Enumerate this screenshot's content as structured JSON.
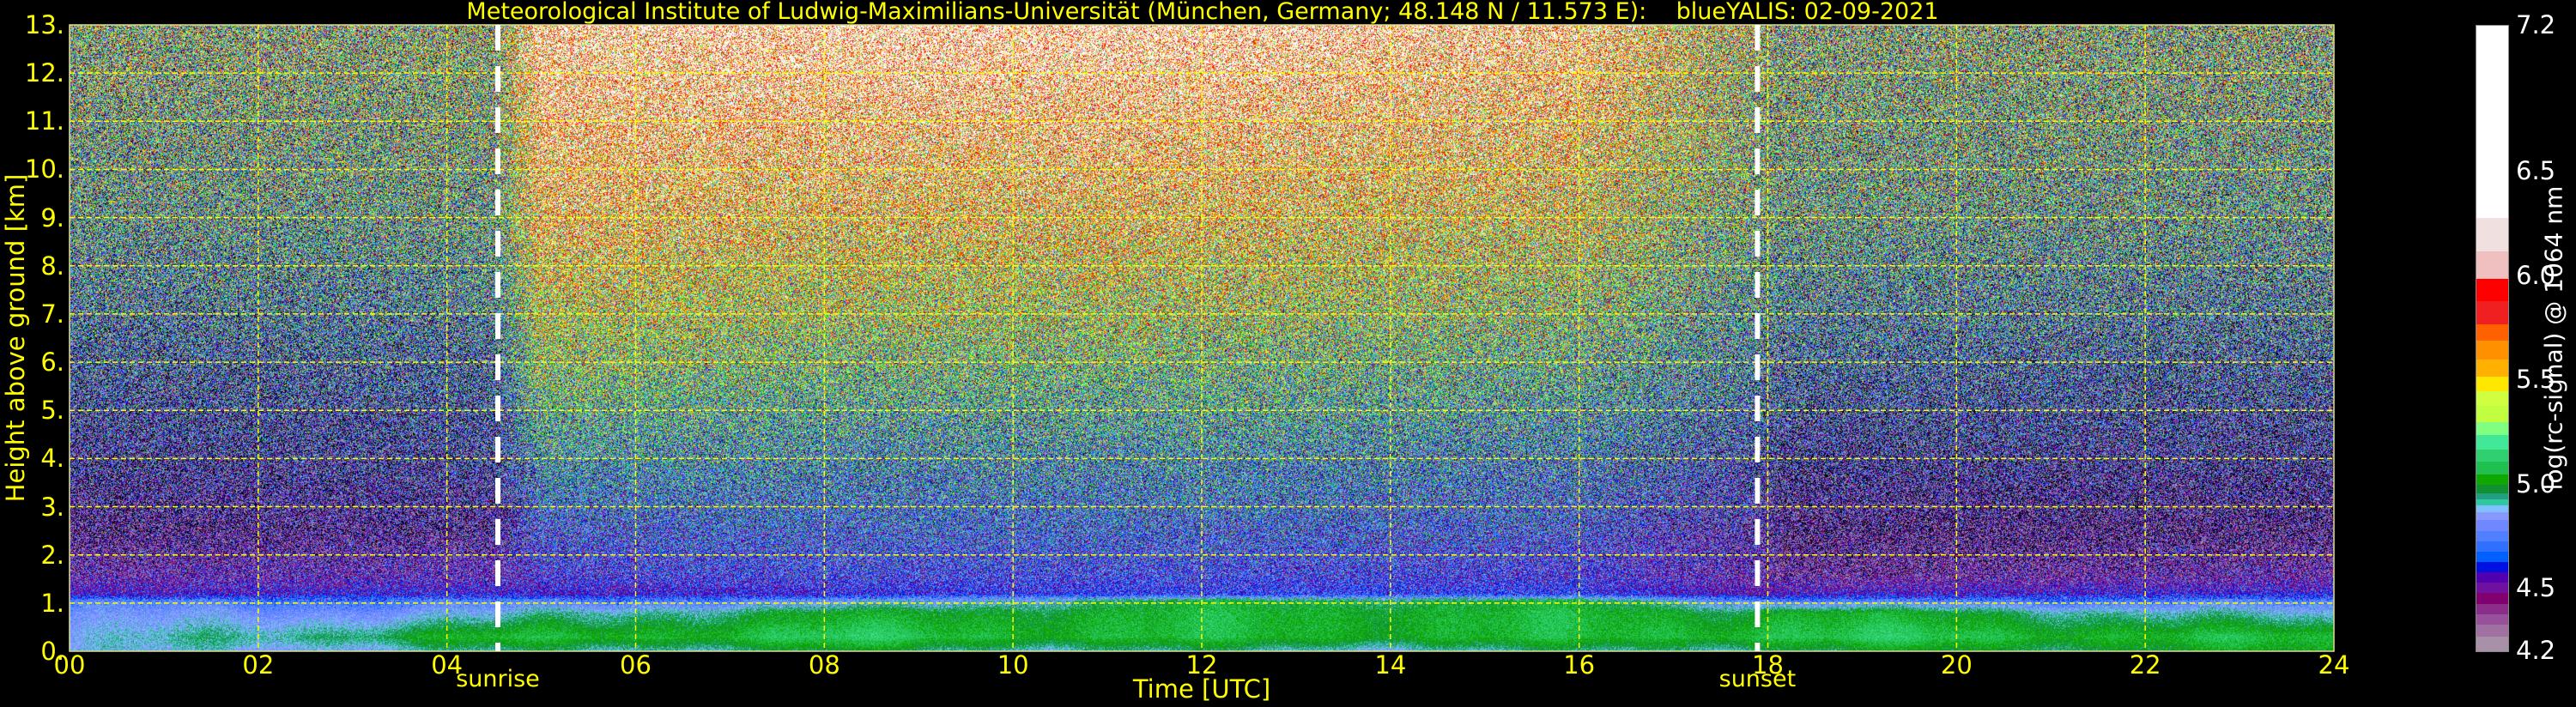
{
  "title": "Meteorological Institute of Ludwig-Maximilians-Universität (München, Germany; 48.148 N / 11.573 E):    blueYALIS: 02-09-2021",
  "chart_data": {
    "type": "heatmap",
    "title": "Meteorological Institute of Ludwig-Maximilians-Universität (München, Germany; 48.148 N / 11.573 E):    blueYALIS: 02-09-2021",
    "xlabel": "Time [UTC]",
    "ylabel": "Height above ground [km]",
    "xlim": [
      0,
      24
    ],
    "ylim": [
      0,
      13
    ],
    "grid": true,
    "grid_color": "#ffff00",
    "x_ticks": [
      0,
      2,
      4,
      6,
      8,
      10,
      12,
      14,
      16,
      18,
      20,
      22,
      24
    ],
    "x_tick_labels": [
      "00",
      "02",
      "04",
      "06",
      "08",
      "10",
      "12",
      "14",
      "16",
      "18",
      "20",
      "22",
      "24"
    ],
    "y_ticks": [
      0,
      1,
      2,
      3,
      4,
      5,
      6,
      7,
      8,
      9,
      10,
      11,
      12,
      13
    ],
    "y_tick_labels": [
      "0.",
      "1.",
      "2.",
      "3.",
      "4.",
      "5.",
      "6.",
      "7.",
      "8.",
      "9.",
      "10.",
      "11.",
      "12.",
      "13."
    ],
    "annotations": [
      {
        "label": "sunrise",
        "time": 4.54
      },
      {
        "label": "sunset",
        "time": 17.89
      }
    ],
    "field": {
      "quantity": "log(rc-signal) @ 1064 nm",
      "times": [
        0,
        4.5,
        5,
        8,
        12,
        16,
        17.9,
        18.2,
        24
      ],
      "heights": [
        0,
        0.3,
        0.8,
        1.05,
        1.2,
        1.6,
        2.5,
        4,
        6,
        9,
        13
      ],
      "mean_values": [
        [
          4.85,
          4.9,
          4.9,
          4.95,
          4.9,
          4.9,
          4.95,
          4.95,
          5.0
        ],
        [
          4.85,
          5.05,
          5.05,
          5.1,
          5.05,
          5.05,
          5.1,
          5.1,
          5.05
        ],
        [
          4.8,
          4.85,
          4.9,
          5.0,
          5.05,
          5.05,
          5.0,
          5.05,
          4.85
        ],
        [
          4.75,
          4.75,
          4.75,
          4.8,
          5.0,
          5.0,
          4.8,
          4.75,
          4.75
        ],
        [
          4.55,
          4.6,
          4.55,
          4.6,
          4.65,
          4.65,
          4.5,
          4.55,
          4.6
        ],
        [
          4.45,
          4.5,
          4.6,
          4.65,
          4.65,
          4.6,
          4.45,
          4.4,
          4.45
        ],
        [
          4.35,
          4.4,
          4.65,
          4.7,
          4.7,
          4.65,
          4.45,
          4.35,
          4.35
        ],
        [
          4.45,
          4.5,
          4.85,
          4.8,
          4.8,
          4.75,
          4.55,
          4.45,
          4.45
        ],
        [
          4.6,
          4.65,
          5.2,
          5.1,
          5.1,
          5.0,
          4.75,
          4.65,
          4.6
        ],
        [
          4.9,
          4.95,
          5.7,
          5.6,
          5.6,
          5.45,
          5.0,
          4.95,
          4.9
        ],
        [
          5.1,
          5.15,
          6.1,
          6.2,
          6.2,
          6.0,
          5.2,
          5.1,
          5.1
        ]
      ],
      "noise_by_height": [
        0.05,
        0.05,
        0.06,
        0.1,
        0.15,
        0.25,
        0.35,
        0.5,
        0.6,
        0.7,
        0.8
      ]
    },
    "colorbar": {
      "label": "log(rc-signal) @ 1064 nm",
      "min": 4.2,
      "max": 7.2,
      "ticks": [
        4.2,
        4.5,
        5.0,
        5.5,
        6.0,
        6.5,
        7.2
      ],
      "tick_labels": [
        "4.2",
        "4.5",
        "5.0",
        "5.5",
        "6.0",
        "6.5",
        "7.2"
      ],
      "bounds": [
        4.2,
        4.27,
        4.33,
        4.38,
        4.43,
        4.48,
        4.53,
        4.58,
        4.63,
        4.68,
        4.73,
        4.78,
        4.83,
        4.87,
        4.9,
        4.93,
        4.96,
        5.0,
        5.05,
        5.11,
        5.17,
        5.24,
        5.3,
        5.38,
        5.45,
        5.52,
        5.6,
        5.69,
        5.77,
        5.88,
        5.99,
        6.12,
        6.28,
        7.2
      ],
      "colors": [
        "#a890a8",
        "#a070a0",
        "#98509a",
        "#8a2e8a",
        "#800070",
        "#7010a0",
        "#5000b0",
        "#0010e0",
        "#0060ff",
        "#3070ff",
        "#5080ff",
        "#7088ff",
        "#8898ff",
        "#80c0ff",
        "#30c8a0",
        "#20a080",
        "#109030",
        "#10a800",
        "#20c050",
        "#30d070",
        "#40e898",
        "#80ff80",
        "#c0ff40",
        "#d0ff40",
        "#ffe800",
        "#ffb000",
        "#ff9000",
        "#ff6000",
        "#f02020",
        "#ff0000",
        "#f0c0c0",
        "#f0e0e0",
        "#ffffff"
      ],
      "under_color": "#000000"
    }
  }
}
